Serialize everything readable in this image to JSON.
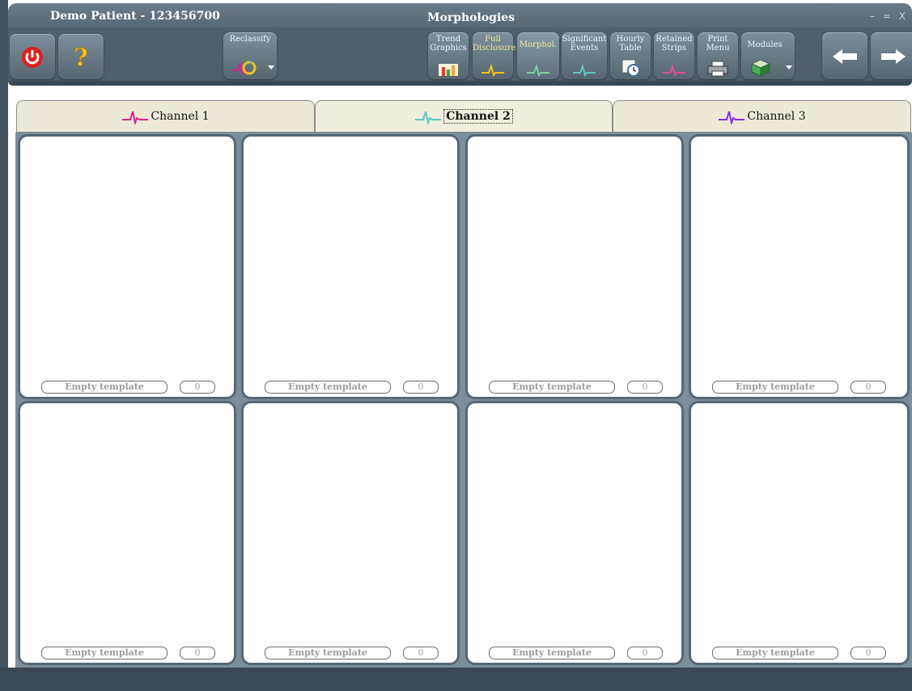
{
  "window": {
    "patient_title": "Demo Patient - 123456700",
    "app_title": "Morphologies",
    "controls": [
      "–",
      "=",
      "X"
    ]
  },
  "toolbar": {
    "power_icon": "power-icon",
    "help_icon": "help-question-icon",
    "reclassify_label": "Reclassify",
    "trend_label": "Trend\nGraphics",
    "full_label": "Full\nDisclosure",
    "morph_label": "Morphol.",
    "sig_label": "Significant\nEvents",
    "hourly_label": "Hourly\nTable",
    "retained_label": "Retained\nStrips",
    "print_label": "Print\nMenu",
    "modules_label": "Modules",
    "colors": {
      "toolbar": "#4f606c",
      "active_label": "#f7e79a"
    }
  },
  "tabs": [
    {
      "label": "Channel 1",
      "color": "#e0208c",
      "active": false
    },
    {
      "label": "Channel 2",
      "color": "#5cc7c4",
      "active": true
    },
    {
      "label": "Channel 3",
      "color": "#8a2be2",
      "active": false
    }
  ],
  "templates": [
    {
      "label": "Empty template",
      "count": "0"
    },
    {
      "label": "Empty template",
      "count": "0"
    },
    {
      "label": "Empty template",
      "count": "0"
    },
    {
      "label": "Empty template",
      "count": "0"
    },
    {
      "label": "Empty template",
      "count": "0"
    },
    {
      "label": "Empty template",
      "count": "0"
    },
    {
      "label": "Empty template",
      "count": "0"
    },
    {
      "label": "Empty template",
      "count": "0"
    }
  ]
}
